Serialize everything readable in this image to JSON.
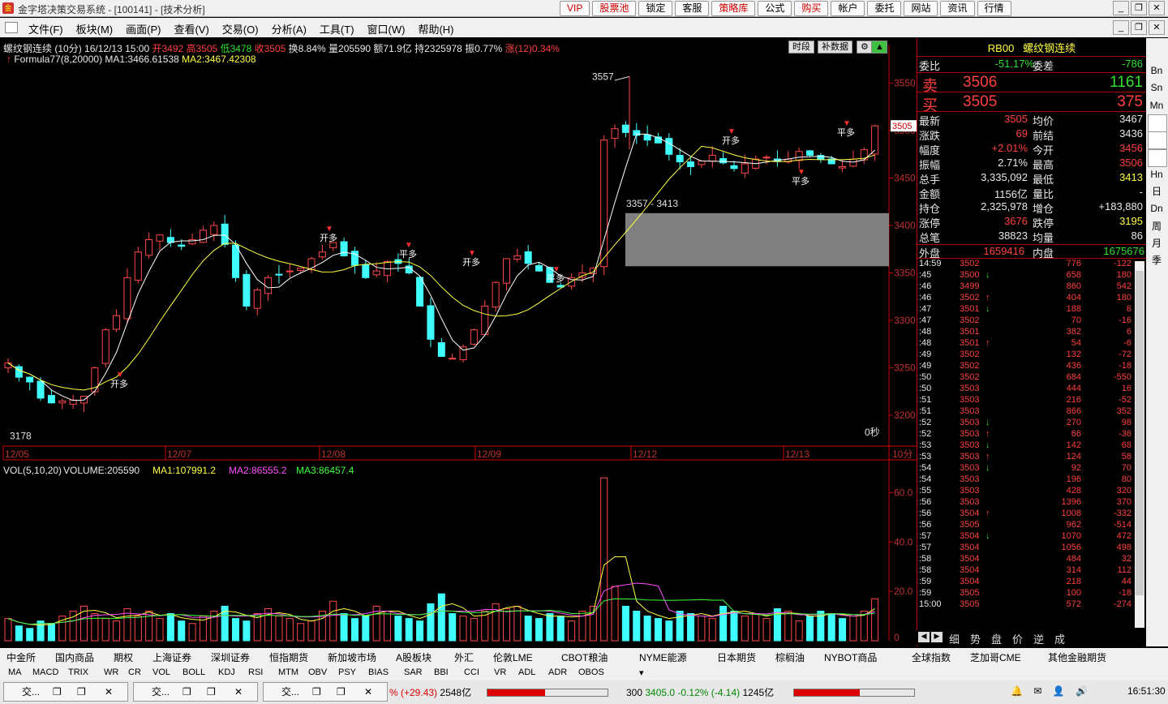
{
  "window": {
    "title": "金字塔决策交易系统 - [100141] - [技术分析]",
    "logo": "金"
  },
  "top_buttons": [
    {
      "label": "VIP",
      "color": "red"
    },
    {
      "label": "股票池",
      "color": "red"
    },
    {
      "label": "锁定",
      "color": "black"
    },
    {
      "label": "客服",
      "color": "black"
    },
    {
      "label": "策略库",
      "color": "red"
    },
    {
      "label": "公式",
      "color": "black"
    },
    {
      "label": "购买",
      "color": "red"
    },
    {
      "label": "帐户",
      "color": "black"
    },
    {
      "label": "委托",
      "color": "black"
    },
    {
      "label": "网站",
      "color": "black"
    },
    {
      "label": "资讯",
      "color": "black"
    },
    {
      "label": "行情",
      "color": "black"
    }
  ],
  "menu": [
    "文件(F)",
    "板块(M)",
    "画面(P)",
    "查看(V)",
    "交易(O)",
    "分析(A)",
    "工具(T)",
    "窗口(W)",
    "帮助(H)"
  ],
  "chart_header": {
    "name": "螺纹钢连续",
    "period": "(10分)",
    "datetime": "16/12/13 15:00",
    "open": "开3492",
    "high": "高3505",
    "low": "低3478",
    "close": "收3505",
    "turnover": "换8.84%",
    "volume": "量205590",
    "amount": "额71.9亿",
    "oi": "持2325978",
    "amp": "振0.77%",
    "chg": "涨(12)0.34%",
    "formula": "Formula77(8,20000)",
    "ma1": "MA1:3466.61538",
    "ma2": "MA2:3467.42308",
    "btn1": "时段",
    "btn2": "补数据"
  },
  "vol_header": {
    "title": "VOL(5,10,20)",
    "volume": "VOLUME:205590",
    "ma1": "MA1:107991.2",
    "ma2": "MA2:86555.2",
    "ma3": "MA3:86457.4"
  },
  "chart_data": {
    "type": "candlestick",
    "price_ylim": [
      3170,
      3565
    ],
    "price_ticks": [
      3200,
      3250,
      3300,
      3350,
      3400,
      3450,
      3500,
      3550
    ],
    "vol_ticks": [
      "20.0",
      "40.0",
      "60.0"
    ],
    "vol_unit": "万",
    "x_labels": [
      "12/05",
      "12/07",
      "12/08",
      "12/09",
      "12/12",
      "12/13"
    ],
    "period_label": "10分",
    "last_price_tag": "3505",
    "annotations": {
      "high_label": "3557",
      "low_label": "3178",
      "range_label": "3357 - 3413",
      "timer": "0秒"
    },
    "signals": [
      "开多",
      "开多",
      "平多",
      "开多",
      "平多",
      "开多",
      "平多",
      "平多",
      "开多",
      "平多"
    ],
    "close_path": [
      3255,
      3240,
      3235,
      3218,
      3213,
      3215,
      3216,
      3220,
      3250,
      3290,
      3305,
      3345,
      3372,
      3385,
      3390,
      3382,
      3378,
      3385,
      3395,
      3400,
      3380,
      3345,
      3315,
      3332,
      3345,
      3348,
      3352,
      3355,
      3365,
      3372,
      3382,
      3368,
      3358,
      3345,
      3352,
      3362,
      3360,
      3350,
      3315,
      3280,
      3262,
      3260,
      3272,
      3290,
      3315,
      3340,
      3365,
      3368,
      3360,
      3352,
      3340,
      3335,
      3345,
      3350,
      3355,
      3490,
      3502,
      3498,
      3495,
      3490,
      3487,
      3475,
      3467,
      3462,
      3468,
      3474,
      3466,
      3460,
      3465,
      3470,
      3472,
      3468,
      3470,
      3478,
      3474,
      3470,
      3465,
      3462,
      3470,
      3480,
      3505
    ],
    "volume_path": [
      9,
      6,
      5,
      8,
      7,
      10,
      12,
      14,
      11,
      9,
      8,
      13,
      10,
      12,
      9,
      11,
      8,
      7,
      10,
      12,
      14,
      9,
      8,
      11,
      13,
      10,
      9,
      7,
      8,
      12,
      16,
      11,
      9,
      10,
      14,
      12,
      10,
      9,
      8,
      15,
      19,
      11,
      10,
      9,
      12,
      15,
      13,
      14,
      10,
      9,
      11,
      10,
      8,
      12,
      14,
      66,
      22,
      14,
      12,
      10,
      9,
      8,
      12,
      11,
      10,
      9,
      14,
      12,
      10,
      11,
      9,
      13,
      12,
      8,
      10,
      12,
      11,
      9,
      10,
      12,
      17
    ]
  },
  "quote": {
    "code": "RB00",
    "name": "螺纹钢连续",
    "weibi_label": "委比",
    "weibi": "-51.17%",
    "weicha_label": "委差",
    "weicha": "-786",
    "sell_label": "卖",
    "sell_price": "3506",
    "sell_vol": "1161",
    "buy_label": "买",
    "buy_price": "3505",
    "buy_vol": "375",
    "rows": [
      {
        "l1": "最新",
        "v1": "3505",
        "c1": "r",
        "l2": "均价",
        "v2": "3467",
        "c2": "w"
      },
      {
        "l1": "涨跌",
        "v1": "69",
        "c1": "r",
        "l2": "前结",
        "v2": "3436",
        "c2": "w"
      },
      {
        "l1": "幅度",
        "v1": "+2.01%",
        "c1": "r",
        "l2": "今开",
        "v2": "3456",
        "c2": "r"
      },
      {
        "l1": "振幅",
        "v1": "2.71%",
        "c1": "w",
        "l2": "最高",
        "v2": "3506",
        "c2": "r"
      },
      {
        "l1": "总手",
        "v1": "3,335,092",
        "c1": "w",
        "l2": "最低",
        "v2": "3413",
        "c2": "y"
      },
      {
        "l1": "金额",
        "v1": "1156亿",
        "c1": "w",
        "l2": "量比",
        "v2": "-",
        "c2": "w"
      },
      {
        "l1": "持仓",
        "v1": "2,325,978",
        "c1": "w",
        "l2": "增仓",
        "v2": "+183,880",
        "c2": "w"
      },
      {
        "l1": "涨停",
        "v1": "3676",
        "c1": "r",
        "l2": "跌停",
        "v2": "3195",
        "c2": "y"
      },
      {
        "l1": "总笔",
        "v1": "38823",
        "c1": "w",
        "l2": "均量",
        "v2": "86",
        "c2": "w"
      }
    ],
    "outer_label": "外盘",
    "outer": "1659416",
    "inner_label": "内盘",
    "inner": "1675676",
    "ticks": [
      {
        "t": "14:59",
        "p": "3502",
        "a": "",
        "v": "776",
        "d": "-122"
      },
      {
        "t": ":45",
        "p": "3500",
        "a": "↓",
        "v": "658",
        "d": "180"
      },
      {
        "t": ":46",
        "p": "3499",
        "a": "",
        "v": "860",
        "d": "542"
      },
      {
        "t": ":46",
        "p": "3502",
        "a": "↑",
        "v": "404",
        "d": "180"
      },
      {
        "t": ":47",
        "p": "3501",
        "a": "↓",
        "v": "188",
        "d": "6"
      },
      {
        "t": ":47",
        "p": "3502",
        "a": "",
        "v": "70",
        "d": "-16"
      },
      {
        "t": ":48",
        "p": "3501",
        "a": "",
        "v": "382",
        "d": "6"
      },
      {
        "t": ":48",
        "p": "3501",
        "a": "↑",
        "v": "54",
        "d": "-6"
      },
      {
        "t": ":49",
        "p": "3502",
        "a": "",
        "v": "132",
        "d": "-72"
      },
      {
        "t": ":49",
        "p": "3502",
        "a": "",
        "v": "436",
        "d": "-18"
      },
      {
        "t": ":50",
        "p": "3502",
        "a": "",
        "v": "684",
        "d": "-550"
      },
      {
        "t": ":50",
        "p": "3503",
        "a": "",
        "v": "444",
        "d": "16"
      },
      {
        "t": ":51",
        "p": "3503",
        "a": "",
        "v": "216",
        "d": "-52"
      },
      {
        "t": ":51",
        "p": "3503",
        "a": "",
        "v": "866",
        "d": "352"
      },
      {
        "t": ":52",
        "p": "3503",
        "a": "↓",
        "v": "270",
        "d": "98"
      },
      {
        "t": ":52",
        "p": "3503",
        "a": "↑",
        "v": "66",
        "d": "-36"
      },
      {
        "t": ":53",
        "p": "3503",
        "a": "↓",
        "v": "142",
        "d": "68"
      },
      {
        "t": ":53",
        "p": "3503",
        "a": "↑",
        "v": "124",
        "d": "58"
      },
      {
        "t": ":54",
        "p": "3503",
        "a": "↓",
        "v": "92",
        "d": "70"
      },
      {
        "t": ":54",
        "p": "3503",
        "a": "",
        "v": "196",
        "d": "80"
      },
      {
        "t": ":55",
        "p": "3503",
        "a": "",
        "v": "428",
        "d": "320"
      },
      {
        "t": ":56",
        "p": "3503",
        "a": "",
        "v": "1396",
        "d": "370"
      },
      {
        "t": ":56",
        "p": "3504",
        "a": "↑",
        "v": "1008",
        "d": "-332"
      },
      {
        "t": ":56",
        "p": "3505",
        "a": "",
        "v": "962",
        "d": "-514"
      },
      {
        "t": ":57",
        "p": "3504",
        "a": "↓",
        "v": "1070",
        "d": "472"
      },
      {
        "t": ":57",
        "p": "3504",
        "a": "",
        "v": "1056",
        "d": "498"
      },
      {
        "t": ":58",
        "p": "3504",
        "a": "",
        "v": "484",
        "d": "32"
      },
      {
        "t": ":58",
        "p": "3504",
        "a": "",
        "v": "314",
        "d": "112"
      },
      {
        "t": ":59",
        "p": "3504",
        "a": "",
        "v": "218",
        "d": "44"
      },
      {
        "t": ":59",
        "p": "3505",
        "a": "",
        "v": "100",
        "d": "-18"
      },
      {
        "t": "15:00",
        "p": "3505",
        "a": "",
        "v": "572",
        "d": "-274"
      }
    ],
    "tabs": [
      "细",
      "势",
      "盘",
      "价",
      "逆",
      "成"
    ]
  },
  "side_buttons": [
    "Bn",
    "Sn",
    "Mn",
    "",
    "",
    "",
    "Hn",
    "日",
    "Dn",
    "周",
    "月",
    "季"
  ],
  "bottom_tabs": [
    "中金所",
    "国内商品",
    "期权",
    "上海证券",
    "深圳证券",
    "恒指期货",
    "新加坡市场",
    "A股板块",
    "外汇",
    "伦敦LME",
    "CBOT粮油",
    "NYME能源",
    "日本期货",
    "棕榈油",
    "NYBOT商品",
    "全球指数",
    "芝加哥CME",
    "其他金融期货"
  ],
  "indicator_tabs": [
    "MA",
    "MACD",
    "TRIX",
    "WR",
    "CR",
    "VOL",
    "BOLL",
    "KDJ",
    "RSI",
    "MTM",
    "OBV",
    "PSY",
    "BIAS",
    "SAR",
    "BBI",
    "CCI",
    "VR",
    "ADL",
    "ADR",
    "OBOS"
  ],
  "tasks": [
    "交...",
    "交...",
    "交..."
  ],
  "status": {
    "s1_chg": "% (+29.43)",
    "s1_amt": "2548亿",
    "s2_code": "300",
    "s2_val": "3405.0",
    "s2_pct": "-0.12%",
    "s2_chg": "(-4.14)",
    "s2_amt": "1245亿",
    "clock": "16:51:30"
  }
}
